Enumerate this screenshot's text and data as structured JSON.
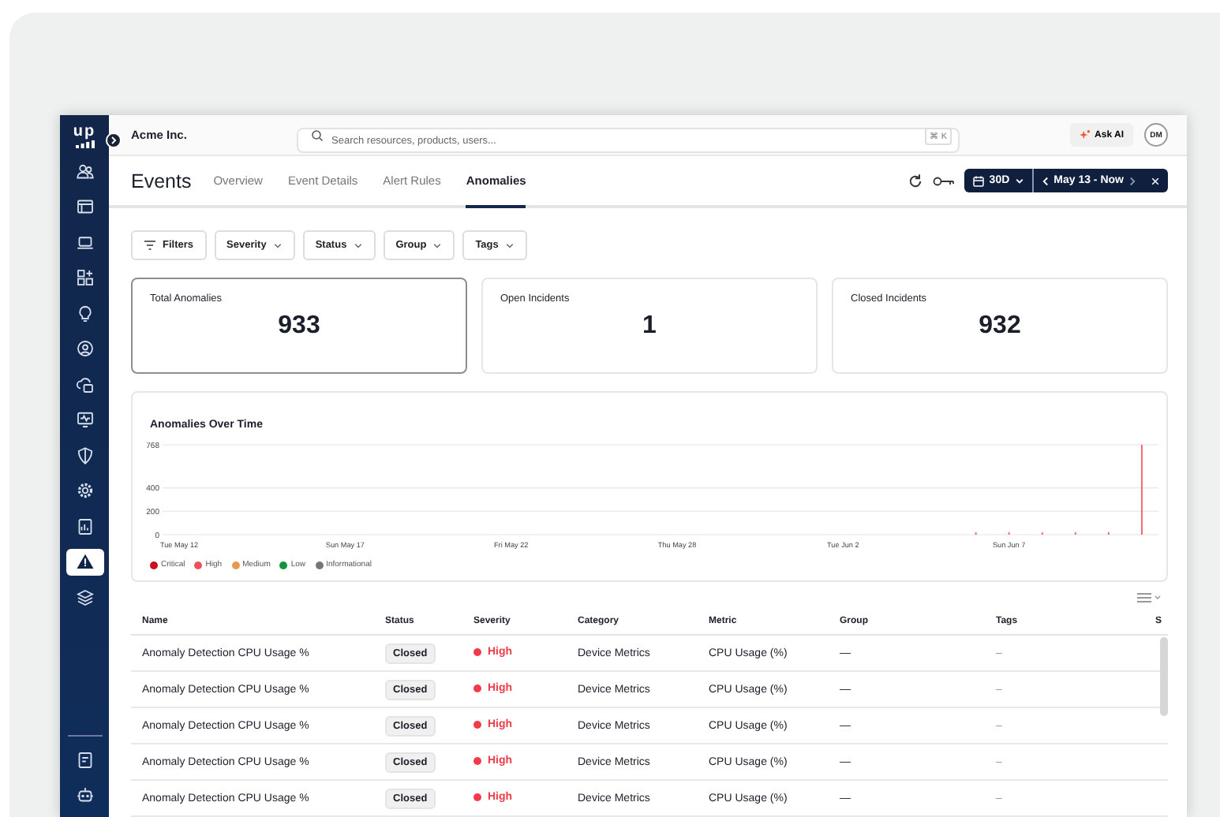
{
  "sidebar": {
    "logo": "up",
    "items": [
      {
        "selected": false
      },
      {
        "selected": false
      },
      {
        "selected": false
      },
      {
        "selected": false
      },
      {
        "selected": false
      },
      {
        "selected": false
      },
      {
        "selected": false
      },
      {
        "selected": false
      },
      {
        "selected": false
      },
      {
        "selected": false
      },
      {
        "selected": false
      },
      {
        "selected": true
      },
      {
        "selected": false
      }
    ],
    "bottom_items": [
      {
        "selected": false
      },
      {
        "selected": false
      }
    ]
  },
  "top_bar": {
    "org": "Acme Inc.",
    "search": {
      "placeholder": "Search resources, products, users...",
      "shortcut": "⌘ K"
    },
    "ask_ai": "Ask AI",
    "avatar": "DM"
  },
  "page": {
    "title": "Events",
    "tabs": [
      {
        "label": "Overview",
        "selected": false
      },
      {
        "label": "Event Details",
        "selected": false
      },
      {
        "label": "Alert Rules",
        "selected": false
      },
      {
        "label": "Anomalies",
        "selected": true
      }
    ],
    "range": {
      "preset": "30D",
      "label": "May 13 - Now"
    }
  },
  "filters": [
    {
      "label": "Filters",
      "kind": "menu"
    },
    {
      "label": "Severity",
      "kind": "dropdown"
    },
    {
      "label": "Status",
      "kind": "dropdown"
    },
    {
      "label": "Group",
      "kind": "dropdown"
    },
    {
      "label": "Tags",
      "kind": "dropdown"
    }
  ],
  "stats": [
    {
      "label": "Total Anomalies",
      "value": "933",
      "selected": true
    },
    {
      "label": "Open Incidents",
      "value": "1",
      "selected": false
    },
    {
      "label": "Closed Incidents",
      "value": "932",
      "selected": false
    }
  ],
  "chart": {
    "chart_data": {
      "type": "bar",
      "title": "Anomalies Over Time",
      "categories": [
        "Tue May 12",
        null,
        null,
        null,
        null,
        "Sun May 17",
        null,
        null,
        null,
        null,
        "Fri May 22",
        null,
        null,
        null,
        null,
        "Thu May 28",
        null,
        null,
        null,
        null,
        "Tue Jun 2",
        null,
        null,
        null,
        null,
        "Sun Jun 7",
        null,
        null,
        null,
        null
      ],
      "series": [
        {
          "color": "#f26b72",
          "values": [
            0,
            0,
            0,
            0,
            0,
            0,
            0,
            0,
            0,
            0,
            0,
            0,
            0,
            0,
            0,
            0,
            0,
            0,
            0,
            0,
            0,
            0,
            0,
            0,
            20,
            20,
            20,
            20,
            20,
            768
          ]
        }
      ],
      "ylim": [
        0,
        768
      ],
      "yticks": [
        0,
        200,
        400,
        768
      ]
    },
    "legend": [
      {
        "label": "Critical",
        "color": "#c8101e"
      },
      {
        "label": "High",
        "color": "#f0505a"
      },
      {
        "label": "Medium",
        "color": "#e89a4c"
      },
      {
        "label": "Low",
        "color": "#14943f"
      },
      {
        "label": "Informational",
        "color": "#767676"
      }
    ]
  },
  "table": {
    "columns": [
      "Name",
      "Status",
      "Severity",
      "Category",
      "Metric",
      "Group",
      "Tags",
      "S"
    ],
    "rows": [
      {
        "name": "Anomaly Detection CPU Usage %",
        "status": "Closed",
        "severity": "High",
        "color": "#f03c48",
        "category": "Device Metrics",
        "metric": "CPU Usage (%)",
        "group": "—",
        "tags": "–"
      },
      {
        "name": "Anomaly Detection CPU Usage %",
        "status": "Closed",
        "severity": "High",
        "color": "#f03c48",
        "category": "Device Metrics",
        "metric": "CPU Usage (%)",
        "group": "—",
        "tags": "–"
      },
      {
        "name": "Anomaly Detection CPU Usage %",
        "status": "Closed",
        "severity": "High",
        "color": "#f03c48",
        "category": "Device Metrics",
        "metric": "CPU Usage (%)",
        "group": "—",
        "tags": "–"
      },
      {
        "name": "Anomaly Detection CPU Usage %",
        "status": "Closed",
        "severity": "High",
        "color": "#f03c48",
        "category": "Device Metrics",
        "metric": "CPU Usage (%)",
        "group": "—",
        "tags": "–"
      },
      {
        "name": "Anomaly Detection CPU Usage %",
        "status": "Closed",
        "severity": "High",
        "color": "#f03c48",
        "category": "Device Metrics",
        "metric": "CPU Usage (%)",
        "group": "—",
        "tags": "–"
      }
    ]
  }
}
